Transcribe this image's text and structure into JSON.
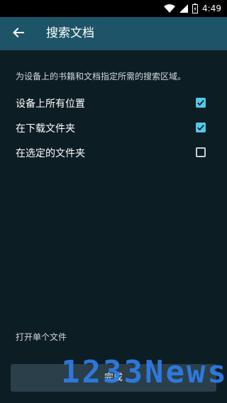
{
  "status_bar": {
    "time": "4:49",
    "icons": [
      "wifi-icon",
      "signal-icon",
      "battery-icon"
    ]
  },
  "app_bar": {
    "back_icon": "arrow-left-icon",
    "title": "搜索文档",
    "background": "#1e5468"
  },
  "description": "为设备上的书籍和文档指定所需的搜索区域。",
  "options": [
    {
      "label": "设备上所有位置",
      "checked": true
    },
    {
      "label": "在下载文件夹",
      "checked": true
    },
    {
      "label": "在选定的文件夹",
      "checked": false
    }
  ],
  "open_single_file": "打开单个文件",
  "done_button": {
    "label": "完成"
  },
  "watermark": "1233News",
  "colors": {
    "background": "#0d1d24",
    "accent": "#53c8e6",
    "button": "#2a3f4a"
  }
}
